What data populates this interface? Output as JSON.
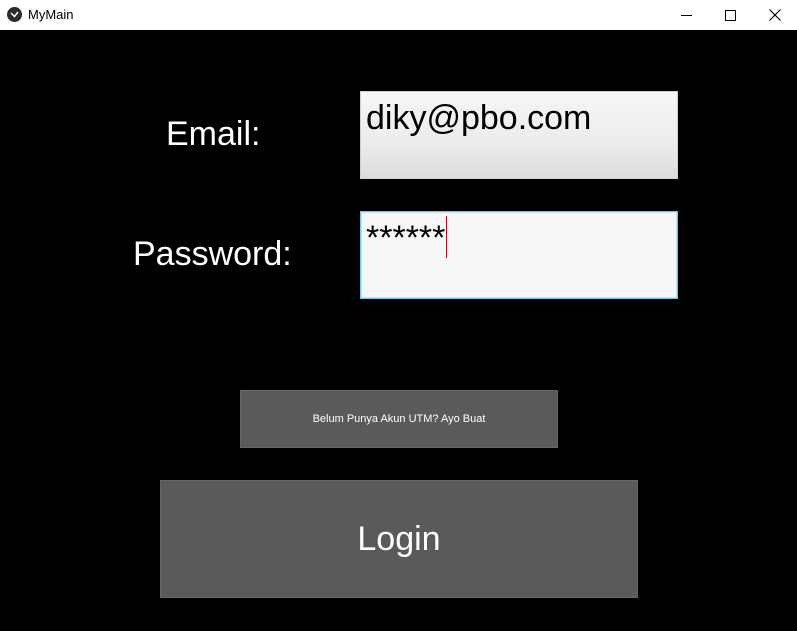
{
  "window": {
    "title": "MyMain",
    "icon": "app-logo-icon",
    "controls": [
      "minimize-icon",
      "maximize-icon",
      "close-icon"
    ]
  },
  "form": {
    "email_label": "Email:",
    "email_value": "diky@pbo.com",
    "password_label": "Password:",
    "password_value": "******"
  },
  "buttons": {
    "register_label": "Belum Punya Akun UTM? Ayo Buat",
    "login_label": "Login"
  },
  "colors": {
    "background": "#000000",
    "button": "#5a5a5a",
    "focus_border": "#7ec6e8",
    "caret": "#a0141e"
  }
}
